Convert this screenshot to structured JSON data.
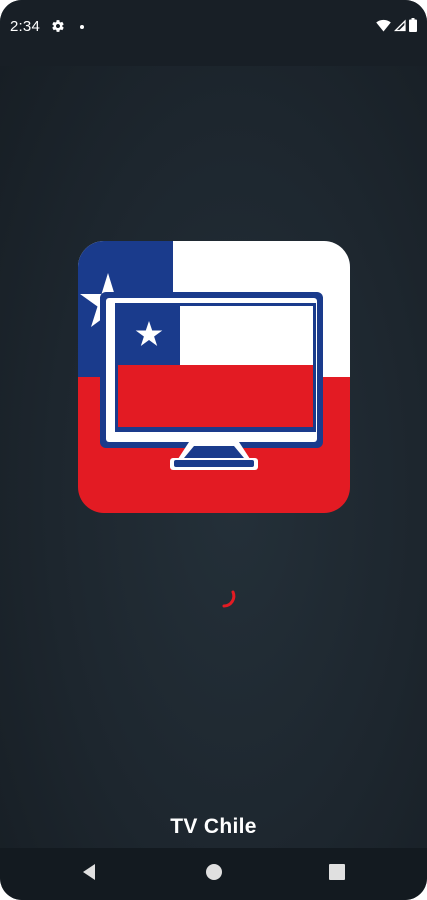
{
  "status_bar": {
    "time": "2:34",
    "icons": [
      "settings-icon",
      "notification-dot",
      "wifi-icon",
      "signal-icon",
      "battery-icon"
    ]
  },
  "splash": {
    "app_name": "TV Chile",
    "icon": "chile-tv-app-icon",
    "loading": true
  },
  "nav_bar": {
    "buttons": [
      "back-icon",
      "home-icon",
      "recents-icon"
    ]
  },
  "colors": {
    "background": "#1d262e",
    "flag_red": "#e31b23",
    "flag_blue": "#1a3b8c",
    "flag_white": "#ffffff",
    "spinner": "#e31b23",
    "text": "#ffffff"
  }
}
